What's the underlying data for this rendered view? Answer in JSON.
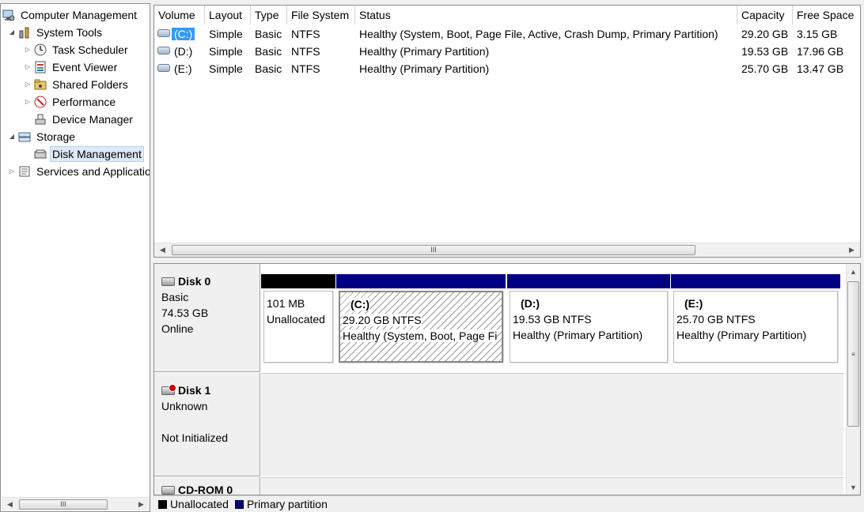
{
  "tree": {
    "items": [
      {
        "label": "Computer Management",
        "icon": "computer-management-icon",
        "expander": ""
      },
      {
        "label": "System Tools",
        "icon": "system-tools-icon",
        "expander": "◢"
      },
      {
        "label": "Task Scheduler",
        "icon": "clock-icon",
        "expander": "▷"
      },
      {
        "label": "Event Viewer",
        "icon": "event-viewer-icon",
        "expander": "▷"
      },
      {
        "label": "Shared Folders",
        "icon": "shared-folder-icon",
        "expander": "▷"
      },
      {
        "label": "Performance",
        "icon": "performance-icon",
        "expander": "▷"
      },
      {
        "label": "Device Manager",
        "icon": "device-manager-icon",
        "expander": ""
      },
      {
        "label": "Storage",
        "icon": "storage-icon",
        "expander": "◢"
      },
      {
        "label": "Disk Management",
        "icon": "disk-management-icon",
        "expander": ""
      },
      {
        "label": "Services and Applications",
        "icon": "services-icon",
        "expander": "▷"
      }
    ],
    "selected": "Disk Management"
  },
  "volumes": {
    "columns": [
      "Volume",
      "Layout",
      "Type",
      "File System",
      "Status",
      "Capacity",
      "Free Space"
    ],
    "rows": [
      {
        "volume": "(C:)",
        "layout": "Simple",
        "type": "Basic",
        "fs": "NTFS",
        "status": "Healthy (System, Boot, Page File, Active, Crash Dump, Primary Partition)",
        "capacity": "29.20 GB",
        "free": "3.15 GB"
      },
      {
        "volume": "(D:)",
        "layout": "Simple",
        "type": "Basic",
        "fs": "NTFS",
        "status": "Healthy (Primary Partition)",
        "capacity": "19.53 GB",
        "free": "17.96 GB"
      },
      {
        "volume": "(E:)",
        "layout": "Simple",
        "type": "Basic",
        "fs": "NTFS",
        "status": "Healthy (Primary Partition)",
        "capacity": "25.70 GB",
        "free": "13.47 GB"
      }
    ]
  },
  "disks": {
    "disk0": {
      "name": "Disk 0",
      "type": "Basic",
      "size": "74.53 GB",
      "state": "Online"
    },
    "disk1": {
      "name": "Disk 1",
      "type": "Unknown",
      "state": "Not Initialized"
    },
    "cdrom": {
      "name": "CD-ROM 0"
    }
  },
  "partitions": [
    {
      "label": "",
      "size": "101 MB",
      "status": "Unallocated",
      "bar_color": "#000000"
    },
    {
      "label": "(C:)",
      "size": "29.20 GB NTFS",
      "status": "Healthy (System, Boot, Page Fi",
      "bar_color": "#000080"
    },
    {
      "label": "(D:)",
      "size": "19.53 GB NTFS",
      "status": "Healthy (Primary Partition)",
      "bar_color": "#000080"
    },
    {
      "label": "(E:)",
      "size": "25.70 GB NTFS",
      "status": "Healthy (Primary Partition)",
      "bar_color": "#000080"
    }
  ],
  "legend": {
    "unallocated": "Unallocated",
    "primary": "Primary partition",
    "unallocated_color": "#000000",
    "primary_color": "#000080"
  },
  "scroll": {
    "thumb_glyph": "III",
    "vthumb_glyph": "≡"
  }
}
